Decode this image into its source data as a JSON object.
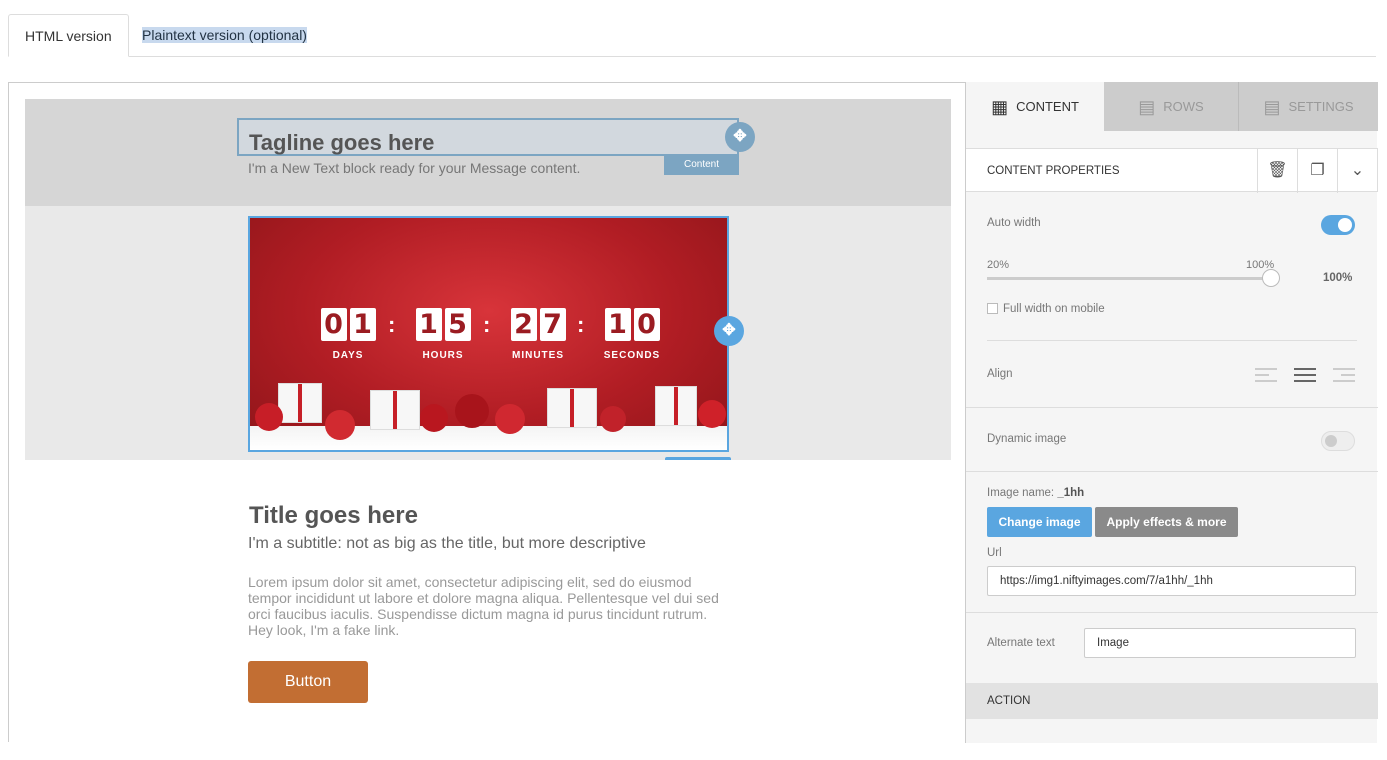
{
  "top_tabs": {
    "html": "HTML version",
    "plaintext": "Plaintext version (optional)"
  },
  "canvas": {
    "tagline": "Tagline goes here",
    "tagline_sub": "I'm a New Text block ready for your Message content.",
    "content_tag": "Content",
    "countdown": [
      {
        "digits": [
          "0",
          "1"
        ],
        "label": "DAYS"
      },
      {
        "digits": [
          "1",
          "5"
        ],
        "label": "HOURS"
      },
      {
        "digits": [
          "2",
          "7"
        ],
        "label": "MINUTES"
      },
      {
        "digits": [
          "1",
          "0"
        ],
        "label": "SECONDS"
      }
    ],
    "colon": ":",
    "title": "Title goes here",
    "subtitle": "I'm a subtitle: not as big as the title, but more descriptive",
    "body": "Lorem ipsum dolor sit amet, consectetur adipiscing elit, sed do eiusmod tempor incididunt ut labore et dolore magna aliqua. Pellentesque vel dui sed orci faucibus iaculis. Suspendisse dictum magna id purus tincidunt rutrum. Hey look, I'm a fake link.",
    "button": "Button",
    "move_icon": "✥",
    "delete_icon": "🗑",
    "duplicate_icon": "❐"
  },
  "panel": {
    "tabs": [
      {
        "label": "CONTENT",
        "icon": "grid-icon",
        "glyph": "▦"
      },
      {
        "label": "ROWS",
        "icon": "rows-icon",
        "glyph": "▤"
      },
      {
        "label": "SETTINGS",
        "icon": "settings-icon",
        "glyph": "▤"
      }
    ],
    "header": "CONTENT PROPERTIES",
    "auto_width": "Auto width",
    "auto_width_on": true,
    "slider": {
      "min_label": "20%",
      "max_label": "100%",
      "value_label": "100%",
      "value": 100
    },
    "full_width_mobile": "Full width on mobile",
    "align": "Align",
    "dynamic_image": "Dynamic image",
    "dynamic_image_on": false,
    "image_name_label": "Image name:",
    "image_name": "_1hh",
    "change_image": "Change image",
    "apply_effects": "Apply effects & more",
    "url_label": "Url",
    "url_value": "https://img1.niftyimages.com/7/a1hh/_1hh",
    "alt_label": "Alternate text",
    "alt_value": "Image",
    "action": "ACTION",
    "colors": {
      "accent": "#5aa6e0",
      "button": "#c26e33"
    }
  }
}
